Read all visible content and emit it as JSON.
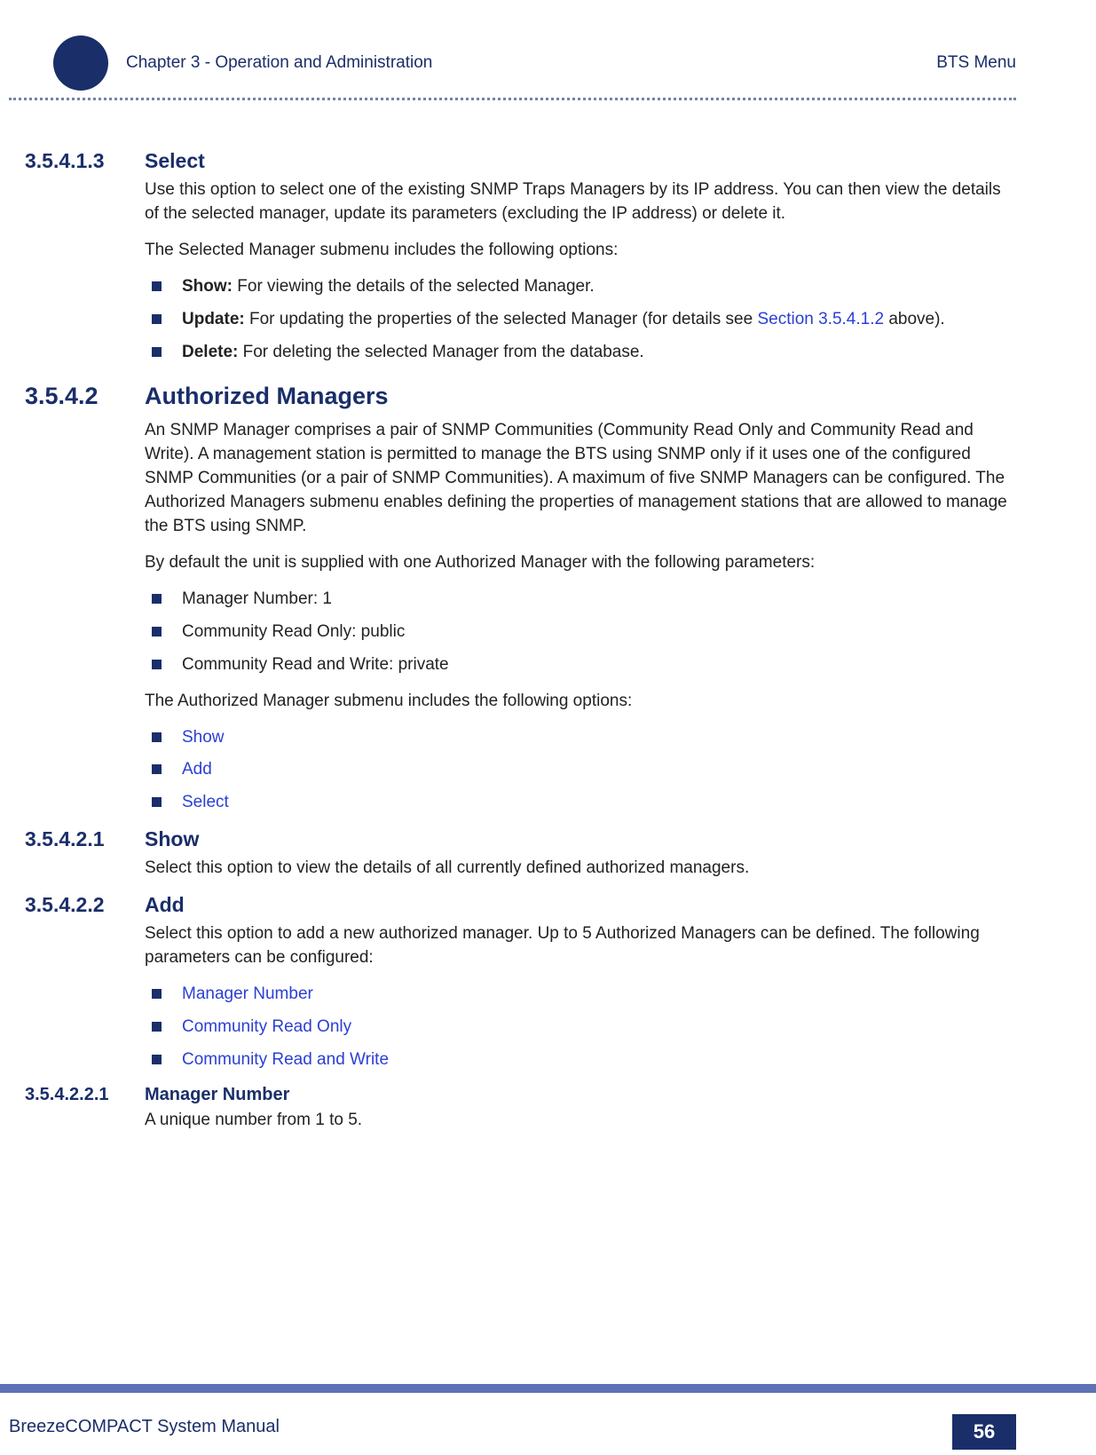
{
  "header": {
    "chapter": "Chapter 3 - Operation and Administration",
    "menu": "BTS Menu"
  },
  "s1": {
    "num": "3.5.4.1.3",
    "title": "Select",
    "p1": "Use this option to select one of the existing SNMP Traps Managers by its IP address. You can then view the details of the selected manager, update its parameters (excluding the IP address) or delete it.",
    "p2": "The Selected Manager submenu includes the following options:",
    "b1_bold": "Show:",
    "b1_rest": " For viewing the details of the selected Manager.",
    "b2_bold": "Update:",
    "b2_rest1": " For updating the properties of the selected Manager (for details see ",
    "b2_link": "Section 3.5.4.1.2",
    "b2_rest2": " above).",
    "b3_bold": "Delete:",
    "b3_rest": " For deleting the selected Manager from the database."
  },
  "s2": {
    "num": "3.5.4.2",
    "title": "Authorized Managers",
    "p1": "An SNMP Manager comprises a pair of SNMP Communities (Community Read Only and Community Read and Write). A management station is permitted to manage the BTS using SNMP only if it uses one of the configured SNMP Communities (or a pair of SNMP Communities). A maximum of five SNMP Managers can be configured. The Authorized Managers submenu enables defining the properties of management stations that are allowed to manage the BTS using SNMP.",
    "p2": "By default the unit is supplied with one Authorized Manager with the following parameters:",
    "defaults": {
      "b1": "Manager Number: 1",
      "b2": "Community Read Only: public",
      "b3": "Community Read and Write: private"
    },
    "p3": "The Authorized Manager submenu includes the following options:",
    "opts": {
      "b1": "Show",
      "b2": "Add",
      "b3": "Select"
    }
  },
  "s3": {
    "num": "3.5.4.2.1",
    "title": "Show",
    "p1": "Select this option to view the details of all currently defined authorized managers."
  },
  "s4": {
    "num": "3.5.4.2.2",
    "title": "Add",
    "p1": "Select this option to add a new authorized manager. Up to 5 Authorized Managers can be defined. The following parameters can be configured:",
    "params": {
      "b1": "Manager Number",
      "b2": "Community Read Only",
      "b3": "Community Read and Write"
    }
  },
  "s5": {
    "num": "3.5.4.2.2.1",
    "title": "Manager Number",
    "p1": "A unique number from 1 to 5."
  },
  "footer": {
    "manual": "BreezeCOMPACT System Manual",
    "page": "56"
  }
}
